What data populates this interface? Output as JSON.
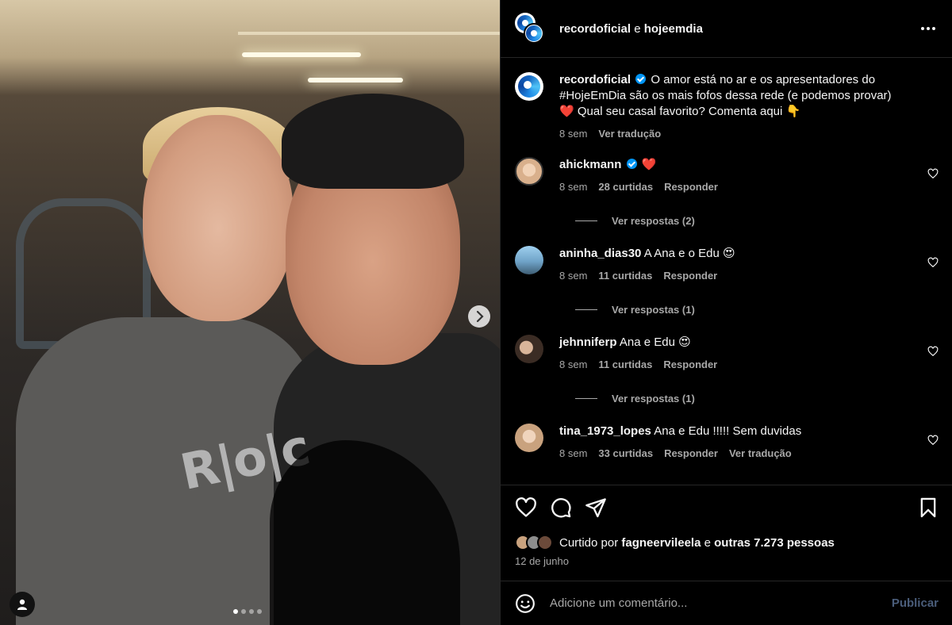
{
  "post": {
    "image_alt": "Selfie",
    "shirt_text": "R|o|c",
    "carousel_dots": 4,
    "carousel_active": 0
  },
  "header": {
    "account1": "recordoficial",
    "joiner": "e",
    "account2": "hojeemdia"
  },
  "caption": {
    "user": "recordoficial",
    "text_line1": "O amor está no ar e os apresentadores do",
    "text_line2": "#HojeEmDia são os mais fofos dessa rede (e podemos provar)",
    "text_line3_heart": "❤️",
    "text_line3": "Qual seu casal favorito? Comenta aqui",
    "text_line3_emoji": "👇",
    "time": "8 sem",
    "translate": "Ver tradução"
  },
  "comments": [
    {
      "user": "ahickmann",
      "verified": true,
      "text": "❤️",
      "time": "8 sem",
      "likes": "28 curtidas",
      "reply": "Responder",
      "replies": "Ver respostas (2)",
      "avatar_color": "#d9b08c"
    },
    {
      "user": "aninha_dias30",
      "verified": false,
      "text": "A Ana e o Edu 😍",
      "time": "8 sem",
      "likes": "11 curtidas",
      "reply": "Responder",
      "replies": "Ver respostas (1)",
      "avatar_color": "#6fa3c8"
    },
    {
      "user": "jehnniferp",
      "verified": false,
      "text": "Ana e Edu 😍",
      "time": "8 sem",
      "likes": "11 curtidas",
      "reply": "Responder",
      "replies": "Ver respostas (1)",
      "avatar_color": "#8a6d5a"
    },
    {
      "user": "tina_1973_lopes",
      "verified": false,
      "text": "Ana e Edu !!!!! Sem duvidas",
      "time": "8 sem",
      "likes": "33 curtidas",
      "reply": "Responder",
      "translate": "Ver tradução",
      "avatar_color": "#c9a27e"
    }
  ],
  "actions": {
    "liked_prefix": "Curtido por",
    "liked_user": "fagneervileela",
    "liked_joiner": "e",
    "liked_others": "outras 7.273 pessoas",
    "date": "12 de junho"
  },
  "composer": {
    "placeholder": "Adicione um comentário...",
    "publish": "Publicar"
  },
  "colors": {
    "background": "#000000",
    "divider": "#262626",
    "secondary_text": "#a8a8a8",
    "verified": "#0095f6",
    "like_red": "#ed4956",
    "publish_disabled": "#4a5d7a"
  }
}
